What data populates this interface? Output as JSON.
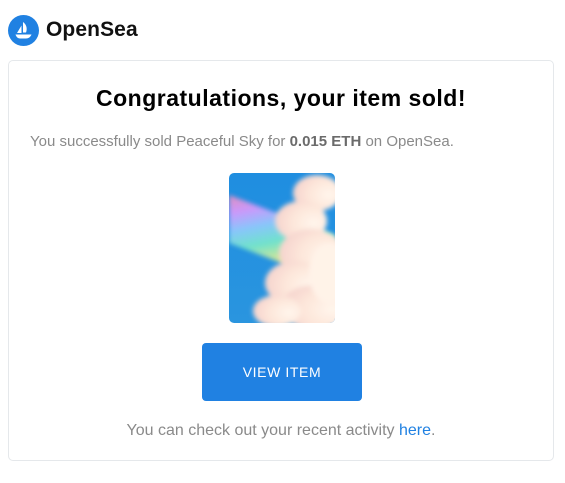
{
  "brand": {
    "name": "OpenSea",
    "color": "#2081e2",
    "logo_icon": "opensea-sailboat-icon"
  },
  "email": {
    "title": "Congratulations, your item sold!",
    "message_prefix": "You successfully sold Peaceful Sky for ",
    "amount": "0.015 ETH",
    "message_suffix": " on OpenSea.",
    "item_image": "peaceful-sky-rainbow-cloud-image",
    "button_label": "VIEW ITEM",
    "footer_prefix": "You can check out your recent activity ",
    "footer_link": "here",
    "footer_suffix": "."
  }
}
